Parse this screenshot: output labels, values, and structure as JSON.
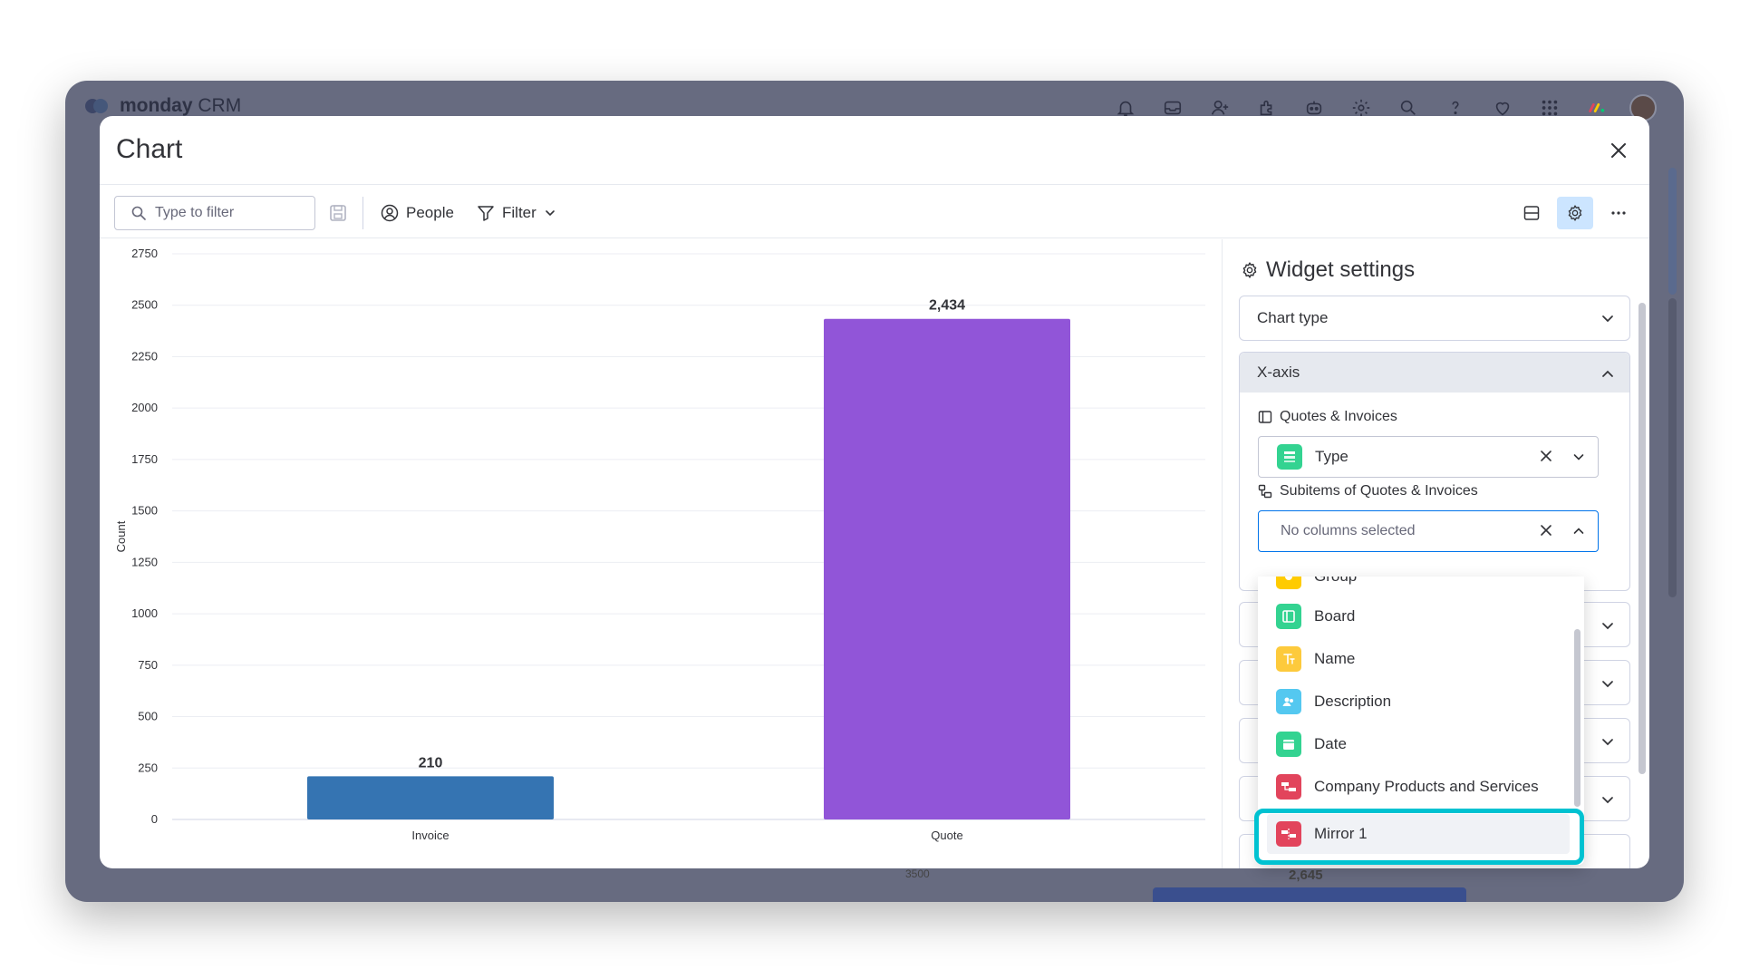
{
  "app": {
    "brand": "monday",
    "product": "CRM",
    "bg_chart": {
      "tick": "3500",
      "value": "2,645"
    }
  },
  "modal": {
    "title": "Chart"
  },
  "toolbar": {
    "search_placeholder": "Type to filter",
    "people_label": "People",
    "filter_label": "Filter"
  },
  "chart_data": {
    "type": "bar",
    "categories": [
      "Invoice",
      "Quote"
    ],
    "values": [
      210,
      2434
    ],
    "value_labels": [
      "210",
      "2,434"
    ],
    "colors": [
      "#3574b2",
      "#9155d8"
    ],
    "ylabel": "Count",
    "ylim": [
      0,
      2750
    ],
    "yticks": [
      0,
      250,
      500,
      750,
      1000,
      1250,
      1500,
      1750,
      2000,
      2250,
      2500,
      2750
    ],
    "grid": true
  },
  "widget_settings": {
    "title": "Widget settings",
    "chart_type_label": "Chart type",
    "xaxis": {
      "label": "X-axis",
      "source1": {
        "label": "Quotes & Invoices",
        "selected": "Type"
      },
      "source2": {
        "label": "Subitems of Quotes & Invoices",
        "placeholder": "No columns selected"
      }
    }
  },
  "dropdown": {
    "items": [
      {
        "label": "Group",
        "color": "#ffcb00"
      },
      {
        "label": "Board",
        "color": "#33d391"
      },
      {
        "label": "Name",
        "color": "#fdca3c"
      },
      {
        "label": "Description",
        "color": "#54c8f0"
      },
      {
        "label": "Date",
        "color": "#33d391"
      },
      {
        "label": "Company Products and Services",
        "color": "#e2445c"
      },
      {
        "label": "Mirror 1",
        "color": "#e2445c"
      }
    ]
  }
}
